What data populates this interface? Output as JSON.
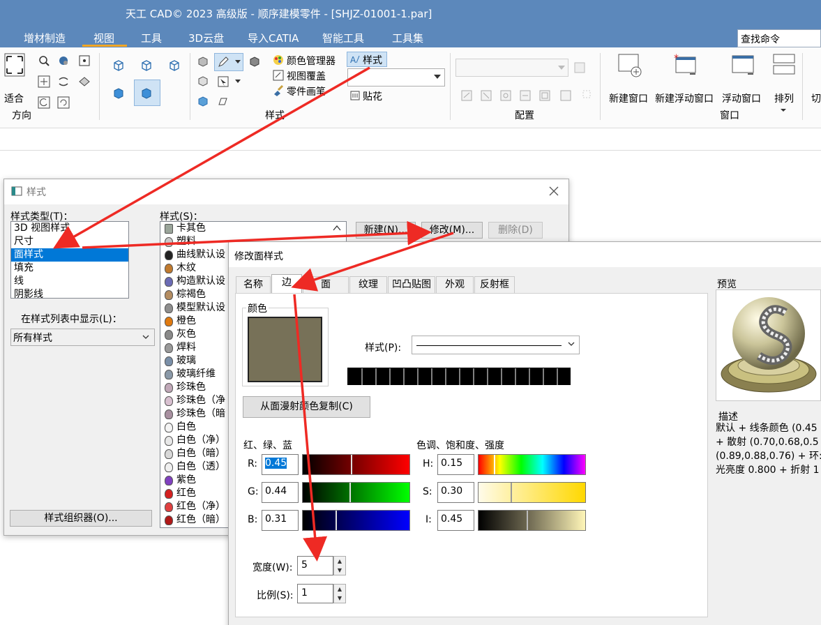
{
  "app": {
    "title": "天工 CAD© 2023 高级版 - 顺序建模零件 - [SHJZ-01001-1.par]",
    "search_label": "查找命令",
    "ribbon_tabs": [
      "增材制造",
      "视图",
      "工具",
      "3D云盘",
      "导入CATIA",
      "智能工具",
      "工具集"
    ],
    "active_tab": "视图"
  },
  "ribbon": {
    "orient_fit": "适合",
    "orient_group": "方向",
    "style_group": "样式",
    "color_manager": "颜色管理器",
    "view_override": "视图覆盖",
    "part_painter": "零件画笔",
    "style_btn": "样式",
    "decal_btn": "贴花",
    "config_group": "配置",
    "new_window": "新建窗口",
    "new_float_window": "新建浮动窗口",
    "float_window": "浮动窗口",
    "arrange": "排列",
    "switch_partial": "切",
    "window_group": "窗口"
  },
  "style_dialog": {
    "title": "样式",
    "type_label": "样式类型(T)：",
    "types": [
      "3D 视图样式",
      "尺寸",
      "面样式",
      "填充",
      "线",
      "阴影线"
    ],
    "selected_type": 2,
    "styles_label": "样式(S)：",
    "styles": [
      "卡其色",
      "塑料",
      "曲线默认设",
      "木纹",
      "构造默认设",
      "棕褐色",
      "模型默认设",
      "橙色",
      "灰色",
      "焊料",
      "玻璃",
      "玻璃纤维",
      "珍珠色",
      "珍珠色（净",
      "珍珠色（暗",
      "白色",
      "白色（净）",
      "白色（暗）",
      "白色（透）",
      "紫色",
      "红色",
      "红色（净）",
      "红色（暗）"
    ],
    "ball_colors": [
      "#9aa59a",
      "#c9c9c9",
      "#222222",
      "#c07a2e",
      "#6b6bb5",
      "#b48d62",
      "#8f8f8f",
      "#e07a10",
      "#8a8a8a",
      "#9a9a9a",
      "#7a8fa8",
      "#8a99a8",
      "#c0a8b8",
      "#d8c0d0",
      "#a890a0",
      "#f4f4f4",
      "#e8e8e8",
      "#d8d8d8",
      "#f0f0f0",
      "#8040c0",
      "#d42020",
      "#e04040",
      "#b01818"
    ],
    "show_label": "在样式列表中显示(L)：",
    "show_value": "所有样式",
    "new_btn": "新建(N)...",
    "modify_btn": "修改(M)...",
    "delete_btn": "删除(D)",
    "organizer_btn": "样式组织器(O)..."
  },
  "modify_dialog": {
    "title": "修改面样式",
    "tabs": [
      "名称",
      "边",
      "面",
      "纹理",
      "凹凸贴图",
      "外观",
      "反射框"
    ],
    "active_tab": "边",
    "color_group": "颜色",
    "swatch_color": "#777158",
    "style_label": "样式(P):",
    "copy_btn": "从面漫射颜色复制(C)",
    "rgb_label": "红、绿、蓝",
    "hsi_label": "色调、饱和度、强度",
    "R_label": "R:",
    "R": "0.45",
    "G_label": "G:",
    "G": "0.44",
    "B_label": "B:",
    "B": "0.31",
    "H_label": "H:",
    "H": "0.15",
    "S_label": "S:",
    "S": "0.30",
    "I_label": "I:",
    "I": "0.45",
    "width_label": "宽度(W):",
    "width": "5",
    "scale_label": "比例(S):",
    "scale": "1",
    "preview_label": "预览",
    "desc_label": "描述",
    "desc_lines": [
      "默认 + 线条颜色 (0.45",
      "+ 散射 (0.70,0.68,0.5",
      "(0.89,0.88,0.76) + 环:",
      "光亮度 0.800 + 折射 1"
    ]
  },
  "colors": {
    "title_bar": "#5c88bb",
    "selection": "#0078d7",
    "annotation_arrow": "#ee2a24"
  }
}
